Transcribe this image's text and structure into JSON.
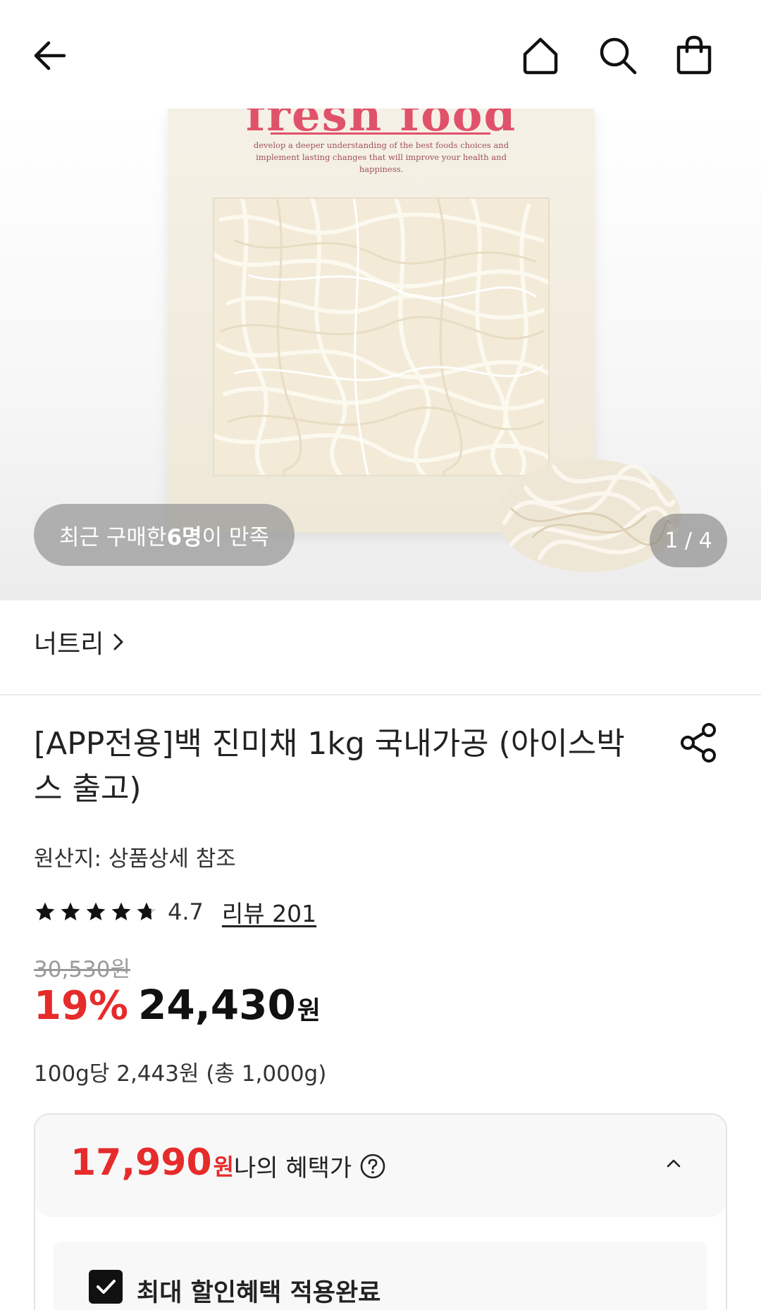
{
  "product_image": {
    "package_brand": "fresh food",
    "package_tagline": "develop a deeper understanding of the best foods choices and implement lasting changes that will improve your health and happiness.",
    "satisfaction_prefix": "최근 구매한 ",
    "satisfaction_count": "6명",
    "satisfaction_suffix": "이 만족",
    "page_indicator": "1 / 4"
  },
  "seller": {
    "name": "너트리"
  },
  "product": {
    "title": "[APP전용]백 진미채 1kg 국내가공 (아이스박스 출고)",
    "origin": "원산지: 상품상세 참조",
    "rating": "4.7",
    "rating_value": 4.7,
    "review_label": "리뷰 201",
    "original_price": "30,530원",
    "discount_rate": "19%",
    "sale_price": "24,430",
    "sale_price_unit": "원",
    "unit_price": "100g당 2,443원 (총 1,000g)"
  },
  "benefit": {
    "price": "17,990",
    "price_unit": "원",
    "label": "나의 혜택가",
    "applied_label": "최대 할인혜택 적용완료",
    "applied_checked": true
  },
  "icons": {
    "back": "arrow-left-icon",
    "home": "home-icon",
    "search": "search-icon",
    "cart": "shopping-bag-icon",
    "share": "share-icon",
    "help": "question-circle-icon",
    "collapse": "chevron-up-icon"
  },
  "colors": {
    "discount_red": "#e62b2b",
    "brand_pink": "#e0526a"
  }
}
